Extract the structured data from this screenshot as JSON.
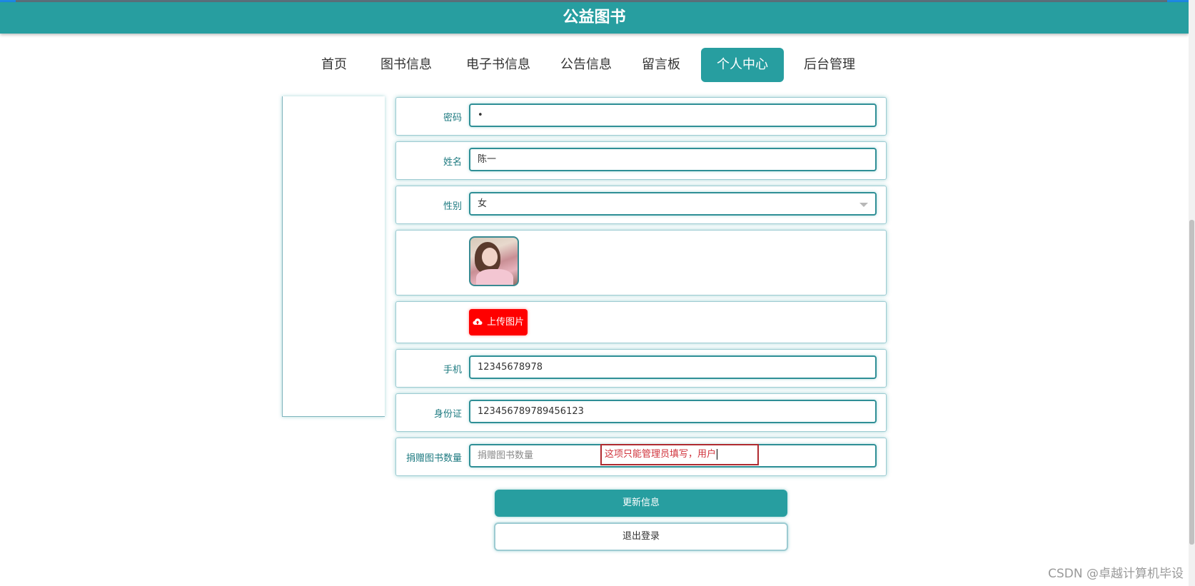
{
  "app": {
    "title": "公益图书"
  },
  "nav": {
    "items": [
      {
        "label": "首页"
      },
      {
        "label": "图书信息"
      },
      {
        "label": "电子书信息"
      },
      {
        "label": "公告信息"
      },
      {
        "label": "留言板"
      },
      {
        "label": "个人中心"
      },
      {
        "label": "后台管理"
      }
    ],
    "active_index": 5
  },
  "form": {
    "password": {
      "label": "密码",
      "value": "•"
    },
    "name": {
      "label": "姓名",
      "value": "陈一"
    },
    "gender": {
      "label": "性别",
      "value": "女"
    },
    "avatar": {
      "icon": "user-photo"
    },
    "upload": {
      "label": "上传图片",
      "icon": "cloud-upload-icon"
    },
    "phone": {
      "label": "手机",
      "value": "12345678978"
    },
    "id_card": {
      "label": "身份证",
      "value": "123456789789456123"
    },
    "donation_count": {
      "label": "捐赠图书数量",
      "placeholder": "捐赠图书数量"
    },
    "tooltip": "这项只能管理员填写，用户"
  },
  "actions": {
    "update": "更新信息",
    "logout": "退出登录"
  },
  "watermark": "CSDN @卓越计算机毕设",
  "colors": {
    "primary": "#279ea0",
    "upload": "#ff0000",
    "tooltip_border": "#b02a30"
  }
}
